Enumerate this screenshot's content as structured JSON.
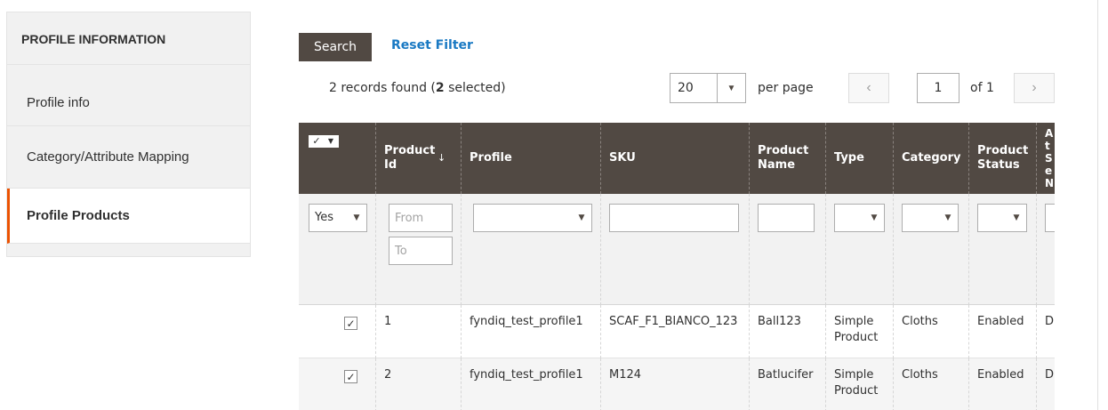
{
  "sidebar": {
    "title": "PROFILE INFORMATION",
    "items": [
      {
        "label": "Profile info"
      },
      {
        "label": "Category/Attribute Mapping"
      },
      {
        "label": "Profile Products"
      }
    ]
  },
  "toolbar": {
    "search_label": "Search",
    "reset_label": "Reset Filter",
    "records_prefix": "2 records found (",
    "records_selected": "2",
    "records_suffix": " selected)",
    "per_page_value": "20",
    "per_page_label": "per page",
    "page_current": "1",
    "page_of": "of 1"
  },
  "grid": {
    "headers": {
      "product_id": "Product Id",
      "profile": "Profile",
      "sku": "SKU",
      "product_name": "Product Name",
      "type": "Type",
      "category": "Category",
      "product_status": "Product Status",
      "attr_set": "At Se N"
    },
    "filters": {
      "mass_value": "Yes",
      "id_from_placeholder": "From",
      "id_to_placeholder": "To"
    },
    "rows": [
      {
        "id": "1",
        "profile": "fyndiq_test_profile1",
        "sku": "SCAF_F1_BIANCO_123",
        "name": "Ball123",
        "type": "Simple Product",
        "category": "Cloths",
        "status": "Enabled",
        "attr": "D"
      },
      {
        "id": "2",
        "profile": "fyndiq_test_profile1",
        "sku": "M124",
        "name": "Batlucifer",
        "type": "Simple Product",
        "category": "Cloths",
        "status": "Enabled",
        "attr": "D"
      }
    ]
  },
  "icons": {
    "checkmark": "✓",
    "dropdown": "▼",
    "sort_arrow": "↓",
    "prev": "‹",
    "next": "›"
  }
}
